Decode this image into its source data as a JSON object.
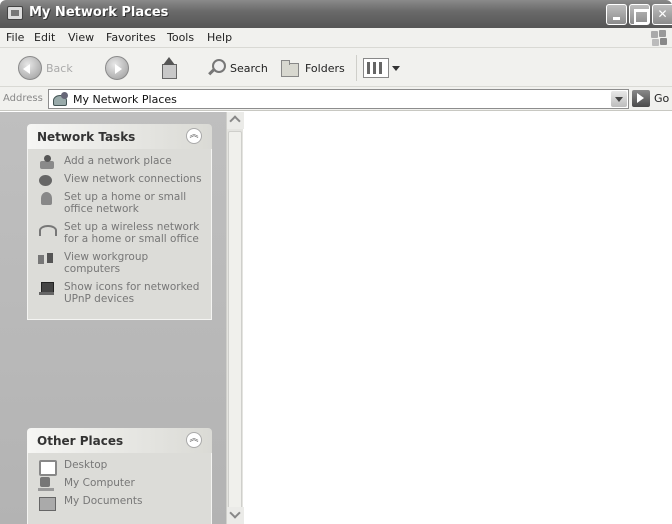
{
  "window": {
    "title": "My Network Places"
  },
  "menu": [
    "File",
    "Edit",
    "View",
    "Favorites",
    "Tools",
    "Help"
  ],
  "toolbar": {
    "back_label": "Back",
    "search_label": "Search",
    "folders_label": "Folders"
  },
  "address": {
    "label": "Address",
    "value": "My Network Places",
    "go_label": "Go"
  },
  "network_tasks": {
    "title": "Network Tasks",
    "items": [
      {
        "icon": "add-network-place-icon",
        "label": "Add a network place"
      },
      {
        "icon": "network-connections-icon",
        "label": "View network connections"
      },
      {
        "icon": "home-network-icon",
        "label": "Set up a home or small office network"
      },
      {
        "icon": "wireless-network-icon",
        "label": "Set up a wireless network for a home or small office"
      },
      {
        "icon": "workgroup-computers-icon",
        "label": "View workgroup computers"
      },
      {
        "icon": "upnp-devices-icon",
        "label": "Show icons for networked UPnP devices"
      }
    ]
  },
  "other_places": {
    "title": "Other Places",
    "items": [
      {
        "icon": "desktop-icon",
        "label": "Desktop"
      },
      {
        "icon": "my-computer-icon",
        "label": "My Computer"
      },
      {
        "icon": "my-documents-icon",
        "label": "My Documents"
      }
    ]
  }
}
